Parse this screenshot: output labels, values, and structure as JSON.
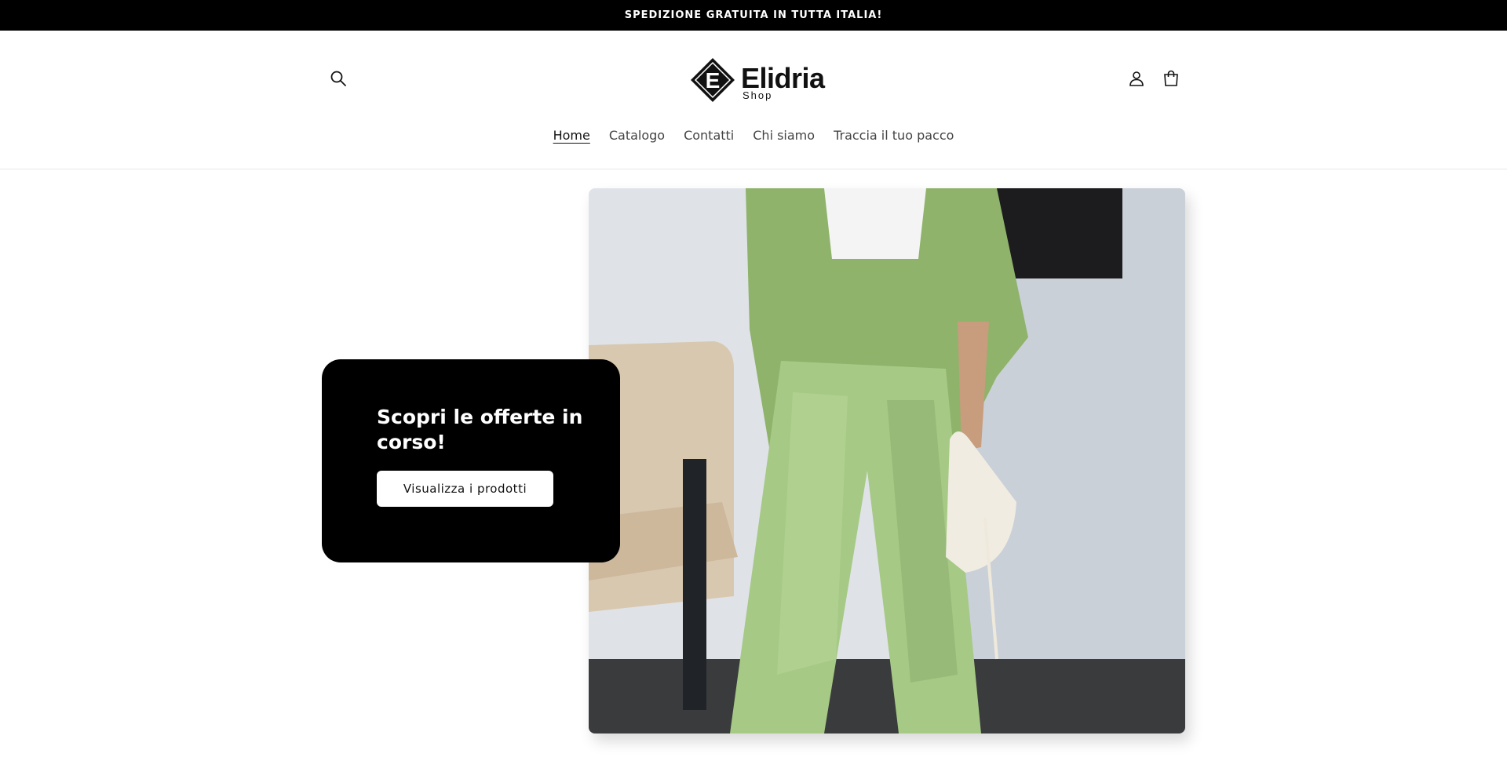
{
  "announcement": {
    "text": "SPEDIZIONE GRATUITA IN TUTTA ITALIA!"
  },
  "header": {
    "logo_name": "Elidria",
    "logo_sub": "Shop",
    "logo_letter": "E",
    "icons": {
      "search": "search-icon",
      "account": "user-icon",
      "cart": "cart-icon"
    }
  },
  "nav": {
    "items": [
      {
        "label": "Home",
        "active": true
      },
      {
        "label": "Catalogo",
        "active": false
      },
      {
        "label": "Contatti",
        "active": false
      },
      {
        "label": "Chi siamo",
        "active": false
      },
      {
        "label": "Traccia il tuo pacco",
        "active": false
      }
    ]
  },
  "hero": {
    "title": "Scopri le offerte in corso!",
    "button_label": "Visualizza i prodotti"
  },
  "colors": {
    "announcement_bg": "#000000",
    "promo_bg": "#000000",
    "outfit_green": "#9bbf72"
  }
}
